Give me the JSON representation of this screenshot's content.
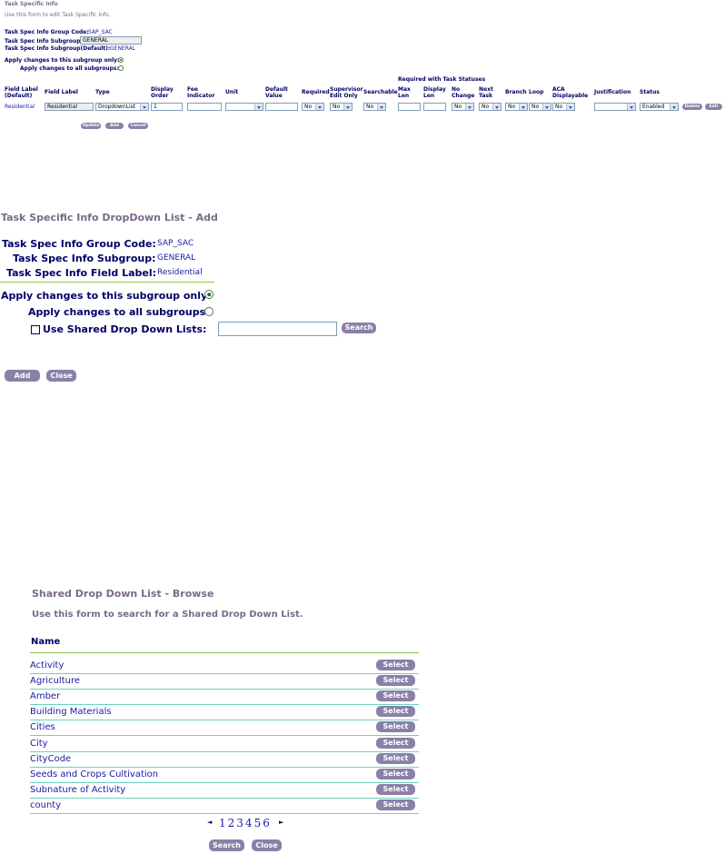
{
  "panel1": {
    "title": "Task Specific Info",
    "subtitle": "Use this form to edit Task Specific Info.",
    "group_code_label": "Task Spec Info Group Code:",
    "group_code_value": "SAP_SAC",
    "subgroup_label": "Task Spec Info Subgroup:",
    "subgroup_value": "GENERAL",
    "subgroup_default_label": "Task Spec Info Subgroup(Default):",
    "subgroup_default_value": "GENERAL",
    "apply_this_label": "Apply changes to this subgroup only:",
    "apply_all_label": "Apply changes to all subgroups:",
    "required_header": "Required with Task Statuses",
    "columns": {
      "field_label_default_1": "Field Label",
      "field_label_default_2": "(Default)",
      "field_label": "Field Label",
      "type": "Type",
      "display_order_1": "Display",
      "display_order_2": "Order",
      "fee_1": "Fee",
      "fee_2": "Indicator",
      "unit": "Unit",
      "default_value_1": "Default",
      "default_value_2": "Value",
      "required": "Required",
      "supervisor_1": "Supervisor",
      "supervisor_2": "Edit Only",
      "searchable": "Searchable",
      "max_len_1": "Max",
      "max_len_2": "Len",
      "display_len_1": "Display",
      "display_len_2": "Len",
      "no_change_1": "No",
      "no_change_2": "Change",
      "next_task_1": "Next",
      "next_task_2": "Task",
      "branch": "Branch",
      "loop": "Loop",
      "aca_1": "ACA",
      "aca_2": "Displayable",
      "justification": "Justification",
      "status": "Status"
    },
    "row": {
      "field_label_default": "Residential",
      "field_label": "Residential",
      "type": "DropdownList",
      "display_order": "1",
      "required": "No",
      "supervisor": "No",
      "searchable": "No",
      "no_change": "No",
      "next_task": "No",
      "branch": "No",
      "loop": "No",
      "aca": "No",
      "status": "Enabled",
      "delete_label": "Delete",
      "edit_label": "Edit"
    },
    "buttons": {
      "update": "Update",
      "add": "Add",
      "cancel": "Cancel"
    }
  },
  "panel2": {
    "title": "Task Specific Info DropDown List - Add",
    "group_code_label": "Task Spec Info Group Code:",
    "group_code_value": "SAP_SAC",
    "subgroup_label": "Task Spec Info Subgroup:",
    "subgroup_value": "GENERAL",
    "field_label_label": "Task Spec Info Field Label:",
    "field_label_value": "Residential",
    "apply_this_label": "Apply changes to this subgroup only:",
    "apply_all_label": "Apply changes to all subgroups:",
    "shared_label": "Use Shared Drop Down Lists:",
    "search_label": "Search",
    "add_label": "Add",
    "close_label": "Close"
  },
  "panel3": {
    "title": "Shared Drop Down List - Browse",
    "subtitle": "Use this form to search for a Shared Drop Down List.",
    "name_header": "Name",
    "select_label": "Select",
    "items": [
      "Activity",
      "Agriculture",
      "Amber",
      "Building Materials",
      "Cities",
      "City",
      "CityCode",
      "Seeds and Crops Cultivation",
      "Subnature of Activity",
      "county"
    ],
    "pages": [
      "1",
      "2",
      "3",
      "4",
      "5",
      "6"
    ],
    "prev_icon": "◄",
    "next_icon": "►",
    "search_label": "Search",
    "close_label": "Close"
  }
}
